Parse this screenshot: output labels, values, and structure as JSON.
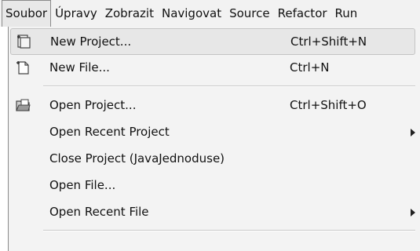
{
  "menubar": {
    "items": [
      {
        "label": "Soubor",
        "active": true
      },
      {
        "label": "Úpravy"
      },
      {
        "label": "Zobrazit"
      },
      {
        "label": "Navigovat"
      },
      {
        "label": "Source"
      },
      {
        "label": "Refactor"
      },
      {
        "label": "Run"
      }
    ]
  },
  "menu": {
    "items": [
      {
        "label": "New Project...",
        "shortcut": "Ctrl+Shift+N",
        "icon": "new-project-icon",
        "hover": true
      },
      {
        "label": "New File...",
        "shortcut": "Ctrl+N",
        "icon": "new-file-icon"
      },
      {
        "label": "Open Project...",
        "shortcut": "Ctrl+Shift+O",
        "icon": "open-project-folder-icon"
      },
      {
        "label": "Open Recent Project",
        "submenu": true
      },
      {
        "label": "Close Project (JavaJednoduse)"
      },
      {
        "label": "Open File..."
      },
      {
        "label": "Open Recent File",
        "submenu": true
      }
    ]
  }
}
